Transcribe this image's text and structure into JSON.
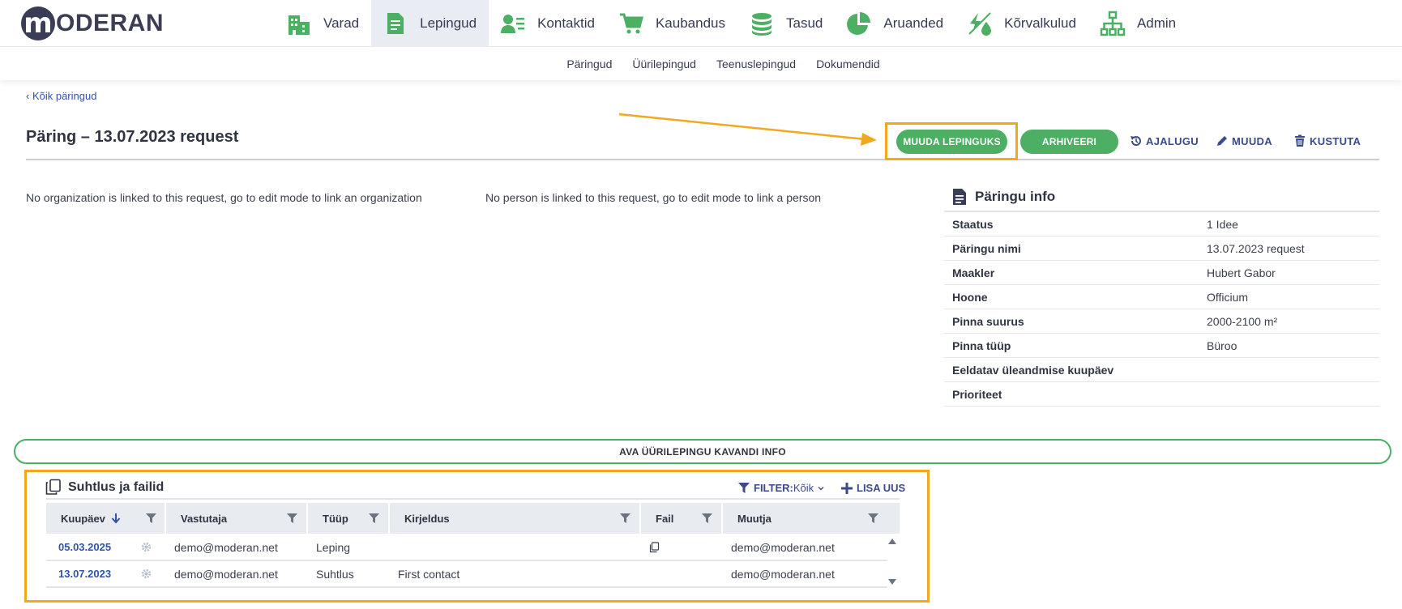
{
  "app": {
    "logo_letter": "m",
    "logo_text": "ODERAN",
    "brand_color": "#3a3d55",
    "accent_color": "#4caf63",
    "highlight_color": "#f2a81e"
  },
  "main_nav": [
    {
      "label": "Varad",
      "icon": "building-icon",
      "active": false
    },
    {
      "label": "Lepingud",
      "icon": "document-icon",
      "active": true
    },
    {
      "label": "Kontaktid",
      "icon": "contact-card-icon",
      "active": false
    },
    {
      "label": "Kaubandus",
      "icon": "cart-icon",
      "active": false
    },
    {
      "label": "Tasud",
      "icon": "coins-icon",
      "active": false
    },
    {
      "label": "Aruanded",
      "icon": "pie-chart-icon",
      "active": false
    },
    {
      "label": "Kõrvalkulud",
      "icon": "utilities-icon",
      "active": false
    },
    {
      "label": "Admin",
      "icon": "org-chart-icon",
      "active": false
    }
  ],
  "sub_nav": [
    "Päringud",
    "Üürilepingud",
    "Teenuslepingud",
    "Dokumendid"
  ],
  "back_link": "‹ Kõik päringud",
  "page": {
    "title": "Päring – 13.07.2023 request"
  },
  "actions": {
    "convert": "MUUDA LEPINGUKS",
    "archive": "ARHIVEERI",
    "history": "AJALUGU",
    "edit": "MUUDA",
    "delete": "KUSTUTA"
  },
  "notes": {
    "organization": "No organization is linked to this request, go to edit mode to link an organization",
    "person": "No person is linked to this request, go to edit mode to link a person"
  },
  "info": {
    "title": "Päringu info",
    "rows": [
      {
        "key": "Staatus",
        "value": "1 Idee"
      },
      {
        "key": "Päringu nimi",
        "value": "13.07.2023 request"
      },
      {
        "key": "Maakler",
        "value": "Hubert Gabor"
      },
      {
        "key": "Hoone",
        "value": "Officium"
      },
      {
        "key": "Pinna suurus",
        "value": "2000-2100 m²"
      },
      {
        "key": "Pinna tüüp",
        "value": "Büroo"
      },
      {
        "key": "Eeldatav üleandmise kuupäev",
        "value": ""
      },
      {
        "key": "Prioriteet",
        "value": ""
      }
    ]
  },
  "open_bar_label": "AVA ÜÜRILEPINGU KAVANDI INFO",
  "communication": {
    "title": "Suhtlus ja failid",
    "filter_label": "FILTER:",
    "filter_value": "Kõik",
    "add_label": "LISA UUS",
    "columns": [
      "Kuupäev",
      "Vastutaja",
      "Tüüp",
      "Kirjeldus",
      "Fail",
      "Muutja"
    ],
    "rows": [
      {
        "date": "05.03.2025",
        "owner": "demo@moderan.net",
        "type": "Leping",
        "description": "",
        "has_file": true,
        "modifier": "demo@moderan.net"
      },
      {
        "date": "13.07.2023",
        "owner": "demo@moderan.net",
        "type": "Suhtlus",
        "description": "First contact",
        "has_file": false,
        "modifier": "demo@moderan.net"
      }
    ]
  }
}
